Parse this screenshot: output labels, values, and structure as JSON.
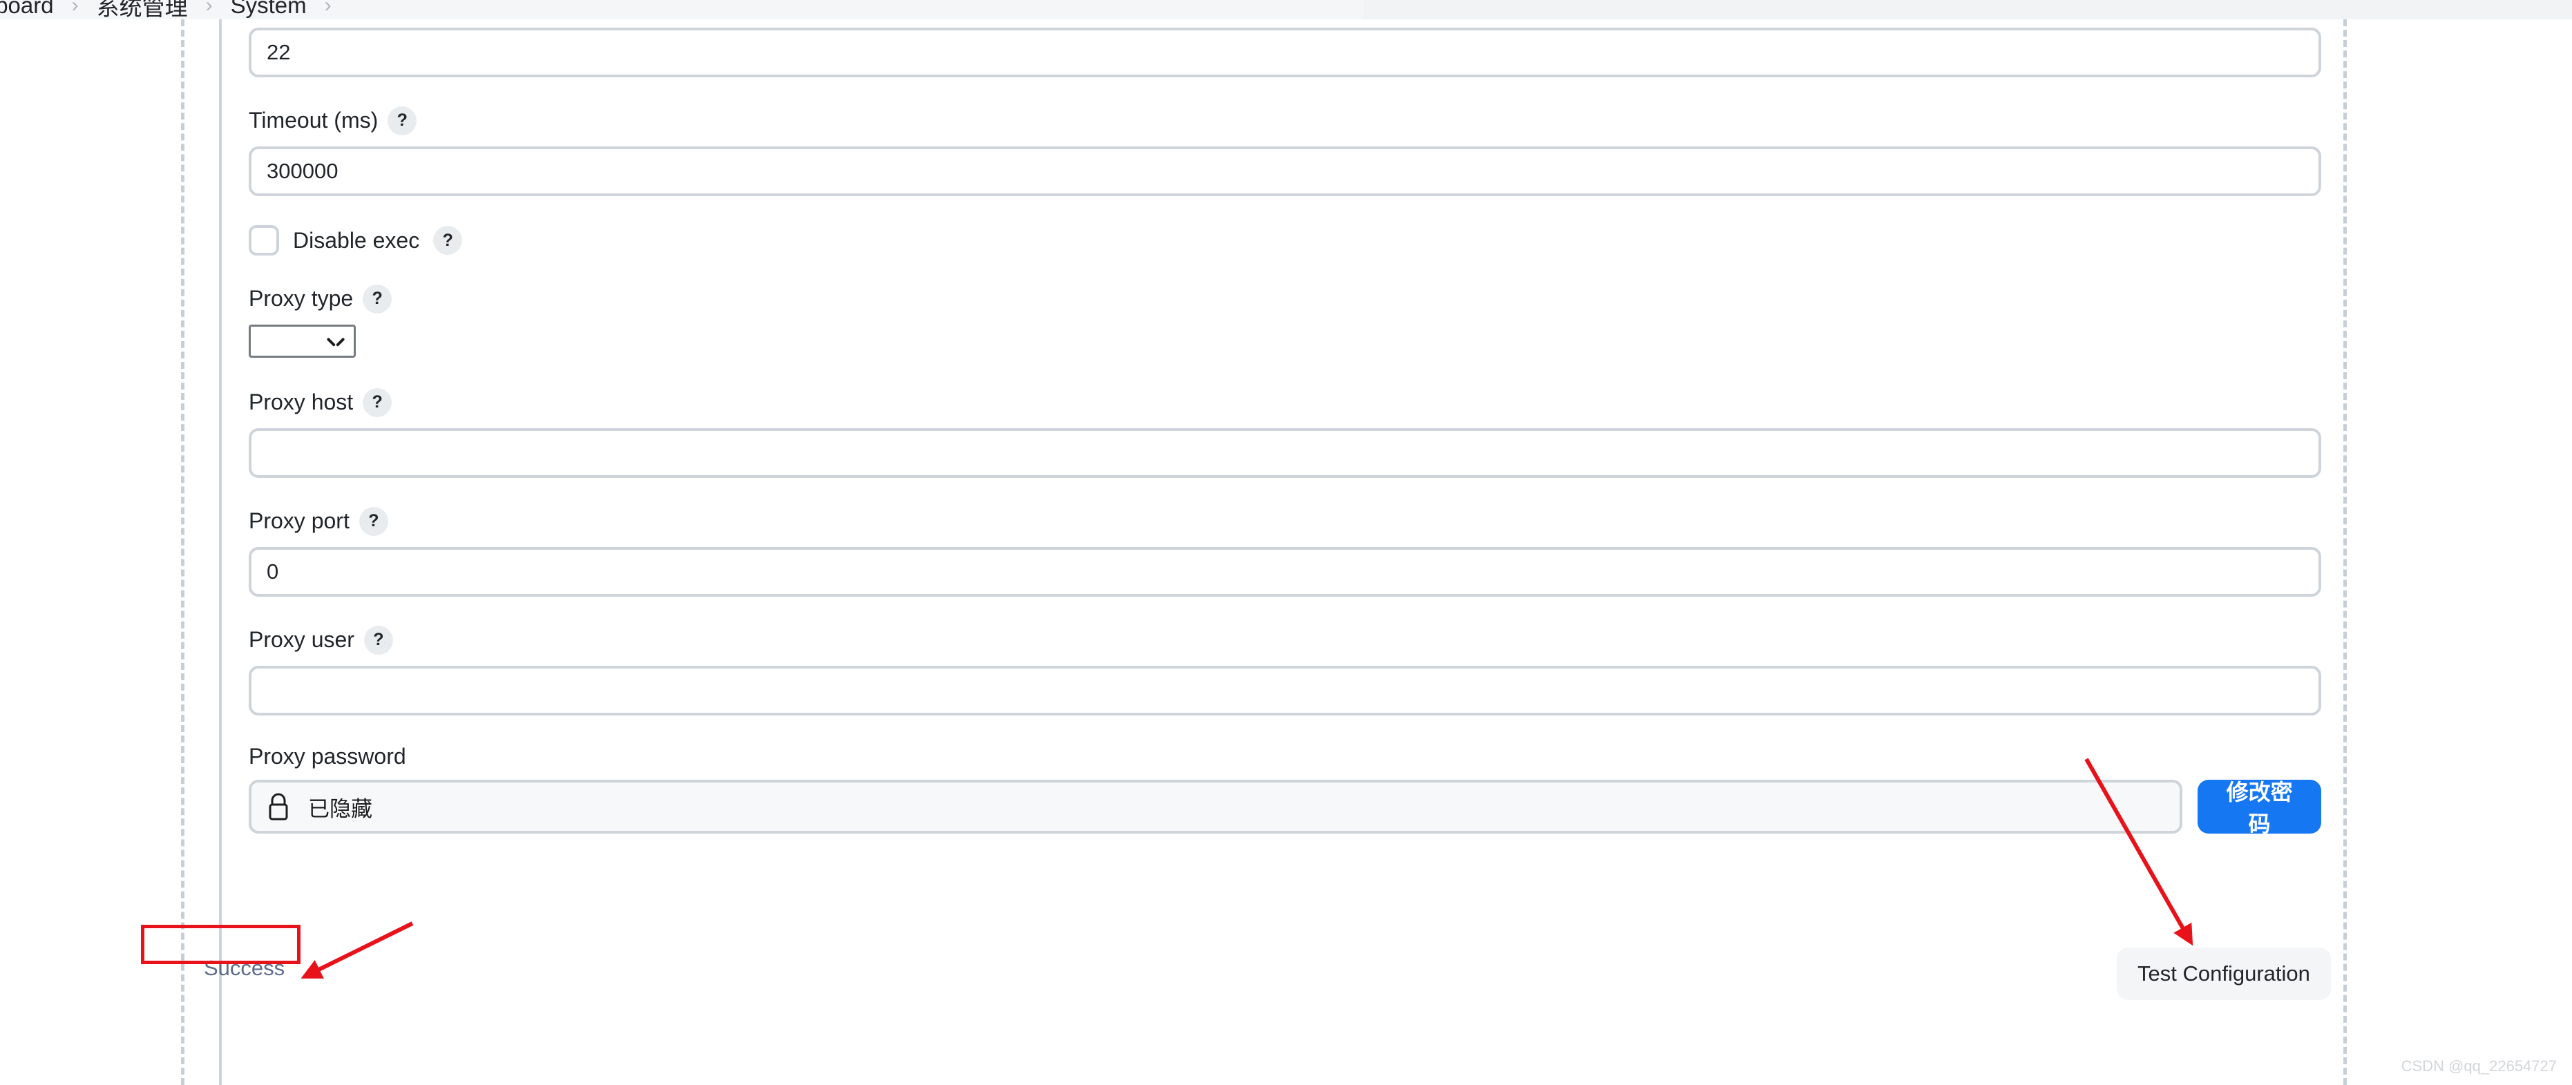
{
  "breadcrumb": {
    "items": [
      "ashboard",
      "系统管理",
      "System"
    ],
    "separator": "›",
    "trailing_separator": "›"
  },
  "form": {
    "port_field": {
      "value": "22"
    },
    "timeout_field": {
      "label": "Timeout (ms)",
      "help": "?",
      "value": "300000"
    },
    "disable_exec": {
      "label": "Disable exec",
      "help": "?",
      "checked": false
    },
    "proxy_type": {
      "label": "Proxy type",
      "help": "?",
      "selected": "",
      "options": [
        ""
      ]
    },
    "proxy_host": {
      "label": "Proxy host",
      "help": "?",
      "value": ""
    },
    "proxy_port": {
      "label": "Proxy port",
      "help": "?",
      "value": "0"
    },
    "proxy_user": {
      "label": "Proxy user",
      "help": "?",
      "value": ""
    },
    "proxy_password": {
      "label": "Proxy password",
      "value": "已隐藏",
      "icon": "lock-icon",
      "change_button_label": "修改密码"
    }
  },
  "actions": {
    "test_configuration_label": "Test Configuration"
  },
  "status": {
    "result_text": "Success"
  },
  "watermark": {
    "text": "CSDN @qq_22654727"
  },
  "colors": {
    "primary_button": "#1677f3",
    "annotation": "#e8121b",
    "status_text": "#5c6b8a",
    "input_border": "#ced4da",
    "help_badge_bg": "#e9ecef"
  }
}
